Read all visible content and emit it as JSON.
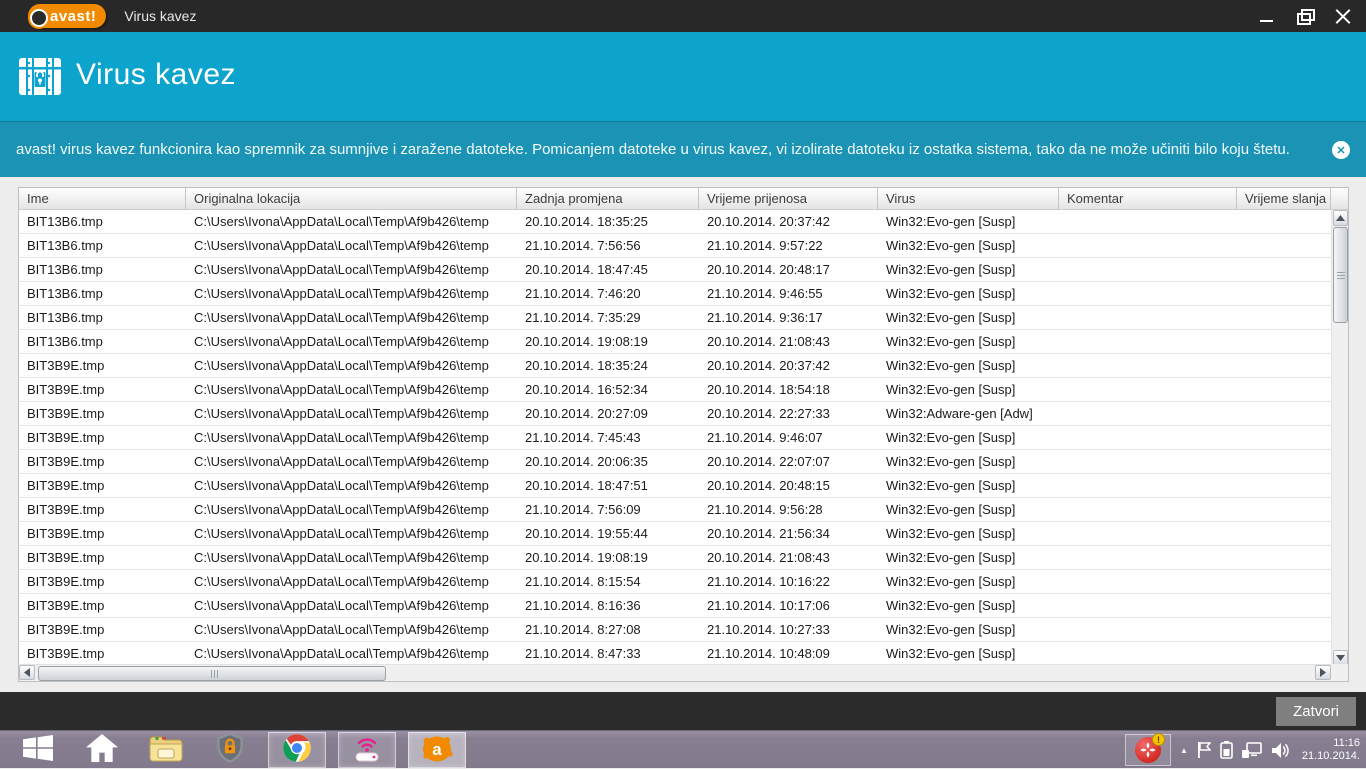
{
  "window": {
    "titlebar": {
      "logo_text": "avast!",
      "title": "Virus kavez"
    },
    "header": {
      "title": "Virus kavez"
    },
    "infobar": {
      "text": "avast! virus kavez funkcionira kao spremnik za sumnjive i zaražene datoteke. Pomicanjem datoteke u virus kavez, vi izolirate datoteku iz ostatka sistema, tako da ne može učiniti bilo koju štetu."
    },
    "table": {
      "columns": [
        "Ime",
        "Originalna lokacija",
        "Zadnja promjena",
        "Vrijeme prijenosa",
        "Virus",
        "Komentar",
        "Vrijeme slanja"
      ],
      "rows": [
        [
          "BIT13B6.tmp",
          "C:\\Users\\Ivona\\AppData\\Local\\Temp\\Af9b426\\temp",
          "20.10.2014. 18:35:25",
          "20.10.2014. 20:37:42",
          "Win32:Evo-gen [Susp]",
          "",
          ""
        ],
        [
          "BIT13B6.tmp",
          "C:\\Users\\Ivona\\AppData\\Local\\Temp\\Af9b426\\temp",
          "21.10.2014. 7:56:56",
          "21.10.2014. 9:57:22",
          "Win32:Evo-gen [Susp]",
          "",
          ""
        ],
        [
          "BIT13B6.tmp",
          "C:\\Users\\Ivona\\AppData\\Local\\Temp\\Af9b426\\temp",
          "20.10.2014. 18:47:45",
          "20.10.2014. 20:48:17",
          "Win32:Evo-gen [Susp]",
          "",
          ""
        ],
        [
          "BIT13B6.tmp",
          "C:\\Users\\Ivona\\AppData\\Local\\Temp\\Af9b426\\temp",
          "21.10.2014. 7:46:20",
          "21.10.2014. 9:46:55",
          "Win32:Evo-gen [Susp]",
          "",
          ""
        ],
        [
          "BIT13B6.tmp",
          "C:\\Users\\Ivona\\AppData\\Local\\Temp\\Af9b426\\temp",
          "21.10.2014. 7:35:29",
          "21.10.2014. 9:36:17",
          "Win32:Evo-gen [Susp]",
          "",
          ""
        ],
        [
          "BIT13B6.tmp",
          "C:\\Users\\Ivona\\AppData\\Local\\Temp\\Af9b426\\temp",
          "20.10.2014. 19:08:19",
          "20.10.2014. 21:08:43",
          "Win32:Evo-gen [Susp]",
          "",
          ""
        ],
        [
          "BIT3B9E.tmp",
          "C:\\Users\\Ivona\\AppData\\Local\\Temp\\Af9b426\\temp",
          "20.10.2014. 18:35:24",
          "20.10.2014. 20:37:42",
          "Win32:Evo-gen [Susp]",
          "",
          ""
        ],
        [
          "BIT3B9E.tmp",
          "C:\\Users\\Ivona\\AppData\\Local\\Temp\\Af9b426\\temp",
          "20.10.2014. 16:52:34",
          "20.10.2014. 18:54:18",
          "Win32:Evo-gen [Susp]",
          "",
          ""
        ],
        [
          "BIT3B9E.tmp",
          "C:\\Users\\Ivona\\AppData\\Local\\Temp\\Af9b426\\temp",
          "20.10.2014. 20:27:09",
          "20.10.2014. 22:27:33",
          "Win32:Adware-gen [Adw]",
          "",
          ""
        ],
        [
          "BIT3B9E.tmp",
          "C:\\Users\\Ivona\\AppData\\Local\\Temp\\Af9b426\\temp",
          "21.10.2014. 7:45:43",
          "21.10.2014. 9:46:07",
          "Win32:Evo-gen [Susp]",
          "",
          ""
        ],
        [
          "BIT3B9E.tmp",
          "C:\\Users\\Ivona\\AppData\\Local\\Temp\\Af9b426\\temp",
          "20.10.2014. 20:06:35",
          "20.10.2014. 22:07:07",
          "Win32:Evo-gen [Susp]",
          "",
          ""
        ],
        [
          "BIT3B9E.tmp",
          "C:\\Users\\Ivona\\AppData\\Local\\Temp\\Af9b426\\temp",
          "20.10.2014. 18:47:51",
          "20.10.2014. 20:48:15",
          "Win32:Evo-gen [Susp]",
          "",
          ""
        ],
        [
          "BIT3B9E.tmp",
          "C:\\Users\\Ivona\\AppData\\Local\\Temp\\Af9b426\\temp",
          "21.10.2014. 7:56:09",
          "21.10.2014. 9:56:28",
          "Win32:Evo-gen [Susp]",
          "",
          ""
        ],
        [
          "BIT3B9E.tmp",
          "C:\\Users\\Ivona\\AppData\\Local\\Temp\\Af9b426\\temp",
          "20.10.2014. 19:55:44",
          "20.10.2014. 21:56:34",
          "Win32:Evo-gen [Susp]",
          "",
          ""
        ],
        [
          "BIT3B9E.tmp",
          "C:\\Users\\Ivona\\AppData\\Local\\Temp\\Af9b426\\temp",
          "20.10.2014. 19:08:19",
          "20.10.2014. 21:08:43",
          "Win32:Evo-gen [Susp]",
          "",
          ""
        ],
        [
          "BIT3B9E.tmp",
          "C:\\Users\\Ivona\\AppData\\Local\\Temp\\Af9b426\\temp",
          "21.10.2014. 8:15:54",
          "21.10.2014. 10:16:22",
          "Win32:Evo-gen [Susp]",
          "",
          ""
        ],
        [
          "BIT3B9E.tmp",
          "C:\\Users\\Ivona\\AppData\\Local\\Temp\\Af9b426\\temp",
          "21.10.2014. 8:16:36",
          "21.10.2014. 10:17:06",
          "Win32:Evo-gen [Susp]",
          "",
          ""
        ],
        [
          "BIT3B9E.tmp",
          "C:\\Users\\Ivona\\AppData\\Local\\Temp\\Af9b426\\temp",
          "21.10.2014. 8:27:08",
          "21.10.2014. 10:27:33",
          "Win32:Evo-gen [Susp]",
          "",
          ""
        ],
        [
          "BIT3B9E.tmp",
          "C:\\Users\\Ivona\\AppData\\Local\\Temp\\Af9b426\\temp",
          "21.10.2014. 8:47:33",
          "21.10.2014. 10:48:09",
          "Win32:Evo-gen [Susp]",
          "",
          ""
        ]
      ]
    },
    "footer": {
      "close_label": "Zatvori"
    }
  },
  "taskbar": {
    "tray": {
      "time": "11:16",
      "date": "21.10.2014."
    }
  },
  "colors": {
    "titlebar": "#282828",
    "header_blue": "#0ca3cc",
    "infobar_blue": "#1b93b4",
    "avast_orange": "#f28a00",
    "button_gray": "#7f7f7f",
    "taskbar_purple": "#877e92",
    "alert_red": "#d42a25"
  }
}
